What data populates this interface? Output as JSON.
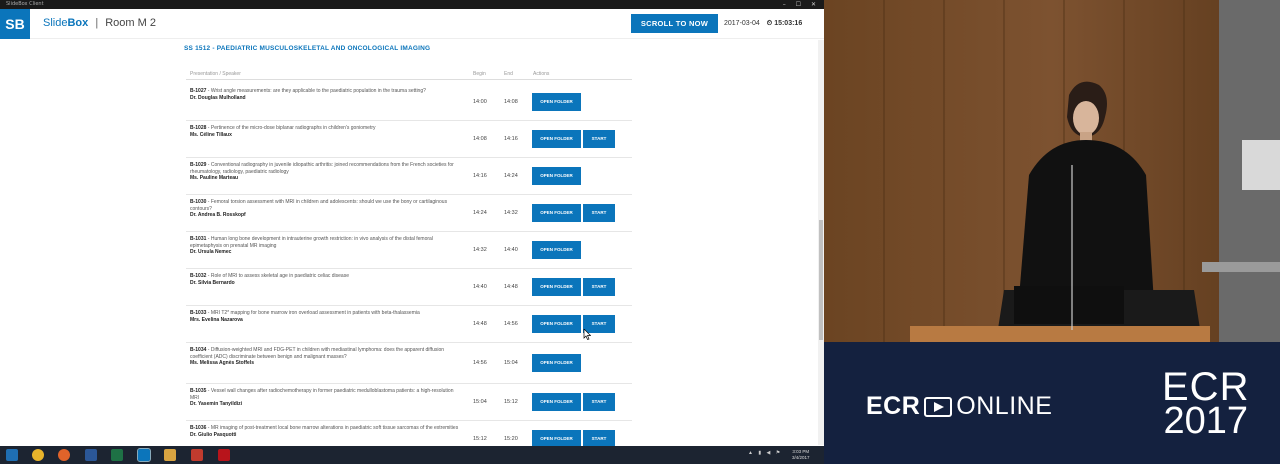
{
  "window": {
    "title": "SlideBox Client",
    "controls": "– ☐ ✕"
  },
  "app": {
    "logo": "SB",
    "name_part1": "Slide",
    "name_part2": "Box",
    "separator": "|",
    "room": "Room M 2",
    "scroll_button": "SCROLL TO NOW",
    "date": "2017-03-04",
    "time": "15:03:16"
  },
  "session": {
    "title": "SS 1512 - PAEDIATRIC MUSCULOSKELETAL AND ONCOLOGICAL IMAGING",
    "columns": {
      "presentation": "Presentation / Speaker",
      "begin": "Begin",
      "end": "End",
      "actions": "Actions"
    },
    "open_folder_label": "OPEN FOLDER",
    "start_label": "START",
    "rows": [
      {
        "code": "B-1027",
        "title": "Wrist angle measurements: are they applicable to the paediatric population in the trauma setting?",
        "speaker": "Dr. Douglas Mulholland",
        "begin": "14:00",
        "end": "14:08",
        "has_start": false
      },
      {
        "code": "B-1028",
        "title": "Pertinence of the micro-dose biplanar radiographs in children's goniometry",
        "speaker": "Ms. Céline Tillaux",
        "begin": "14:08",
        "end": "14:16",
        "has_start": true
      },
      {
        "code": "B-1029",
        "title": "Conventional radiography in juvenile idiopathic arthritis: joined recommendations from the French societies for rheumatology, radiology, paediatric radiology",
        "speaker": "Ms. Pauline Marteau",
        "begin": "14:16",
        "end": "14:24",
        "has_start": false
      },
      {
        "code": "B-1030",
        "title": "Femoral torsion assessment with MRI in children and adolescents: should we use the bony or cartilaginous contours?",
        "speaker": "Dr. Andrea B. Rosskopf",
        "begin": "14:24",
        "end": "14:32",
        "has_start": true
      },
      {
        "code": "B-1031",
        "title": "Human long bone development in intrauterine growth restriction: in vivo analysis of the distal femoral epimetaphysis on prenatal MR imaging",
        "speaker": "Dr. Ursula Nemec",
        "begin": "14:32",
        "end": "14:40",
        "has_start": false
      },
      {
        "code": "B-1032",
        "title": "Role of MRI to assess skeletal age in paediatric celiac disease",
        "speaker": "Dr. Silvia Bernardo",
        "begin": "14:40",
        "end": "14:48",
        "has_start": true
      },
      {
        "code": "B-1033",
        "title": "MRI T2* mapping for bone marrow iron overload assessment in patients with beta-thalassemia",
        "speaker": "Mrs. Evelina Nazarova",
        "begin": "14:48",
        "end": "14:56",
        "has_start": true
      },
      {
        "code": "B-1034",
        "title": "Diffusion-weighted MRI and FDG-PET in children with mediastinal lymphoma: does the apparent diffusion coefficient (ADC) discriminate between benign and malignant masses?",
        "speaker": "Ms. Melissa Agnès Stoffels",
        "begin": "14:56",
        "end": "15:04",
        "has_start": false
      },
      {
        "code": "B-1035",
        "title": "Vessel wall changes after radiochemotherapy in former paediatric medulloblastoma patients: a high-resolution MRI",
        "speaker": "Dr. Yasemin Tanyildizi",
        "begin": "15:04",
        "end": "15:12",
        "has_start": true
      },
      {
        "code": "B-1036",
        "title": "MR imaging of post-treatment local bone marrow alterations in paediatric soft tissue sarcomas of the extremities",
        "speaker": "Dr. Giulio Pasquotti",
        "begin": "15:12",
        "end": "15:20",
        "has_start": true
      }
    ]
  },
  "taskbar": {
    "clock_time": "3:03 PM",
    "clock_date": "3/4/2017"
  },
  "branding": {
    "online_left": "ECR",
    "online_right": "ONLINE",
    "year_top": "ECR",
    "year_bottom": "2017"
  },
  "colors": {
    "accent": "#0b75bb",
    "brand_panel": "#14213f"
  }
}
